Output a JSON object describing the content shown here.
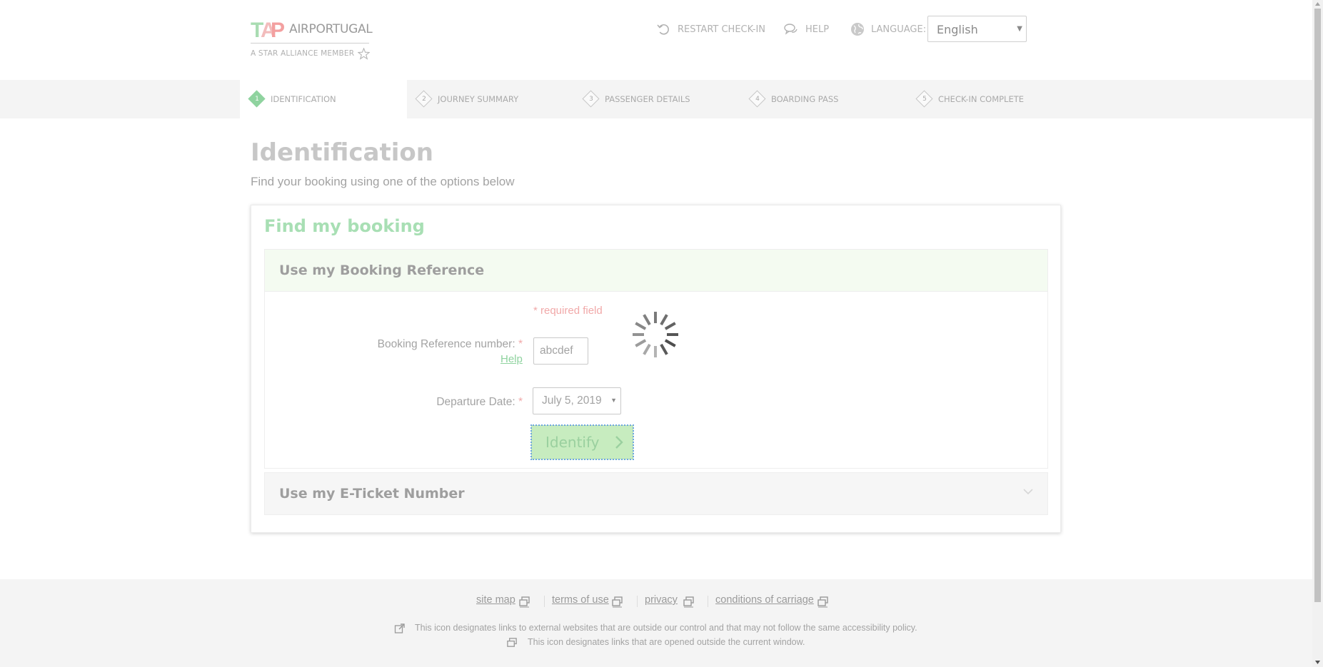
{
  "header": {
    "logo_name": "AIRPORTUGAL",
    "logo_mark": "TAP",
    "alliance_text": "A STAR ALLIANCE MEMBER",
    "restart_label": "RESTART CHECK-IN",
    "help_label": "HELP",
    "language_label": "LANGUAGE:",
    "language_value": "English",
    "icons": [
      "restart-icon",
      "chat-help-icon",
      "globe-icon",
      "star-alliance-icon"
    ]
  },
  "steps": [
    {
      "num": "1",
      "label": "IDENTIFICATION",
      "active": true
    },
    {
      "num": "2",
      "label": "JOURNEY SUMMARY",
      "active": false
    },
    {
      "num": "3",
      "label": "PASSENGER DETAILS",
      "active": false
    },
    {
      "num": "4",
      "label": "BOARDING PASS",
      "active": false
    },
    {
      "num": "5",
      "label": "CHECK-IN COMPLETE",
      "active": false
    }
  ],
  "main": {
    "title": "Identification",
    "subtitle": "Find your booking using one of the options below",
    "panel_title": "Find my booking",
    "booking_ref_section": {
      "title": "Use my Booking Reference",
      "required_note": "* required field",
      "ref_label": "Booking Reference number:",
      "ref_required": "*",
      "ref_help": "Help",
      "ref_value": "abcdef",
      "date_label": "Departure Date:",
      "date_required": "*",
      "date_value": "July 5, 2019",
      "identify_label": "Identify"
    },
    "eticket_section": {
      "title": "Use my E-Ticket Number"
    }
  },
  "footer": {
    "links": [
      "site map",
      "terms of use",
      "privacy",
      "conditions of carriage"
    ],
    "note_external": "This icon designates links to external websites that are outside our control and that may not follow the same accessibility policy.",
    "note_new_window": "This icon designates links that are opened outside the current window."
  },
  "colors": {
    "accent_green": "#8fd39f",
    "required_red": "#f1a9a9",
    "button_bg": "#c7ecbf"
  }
}
